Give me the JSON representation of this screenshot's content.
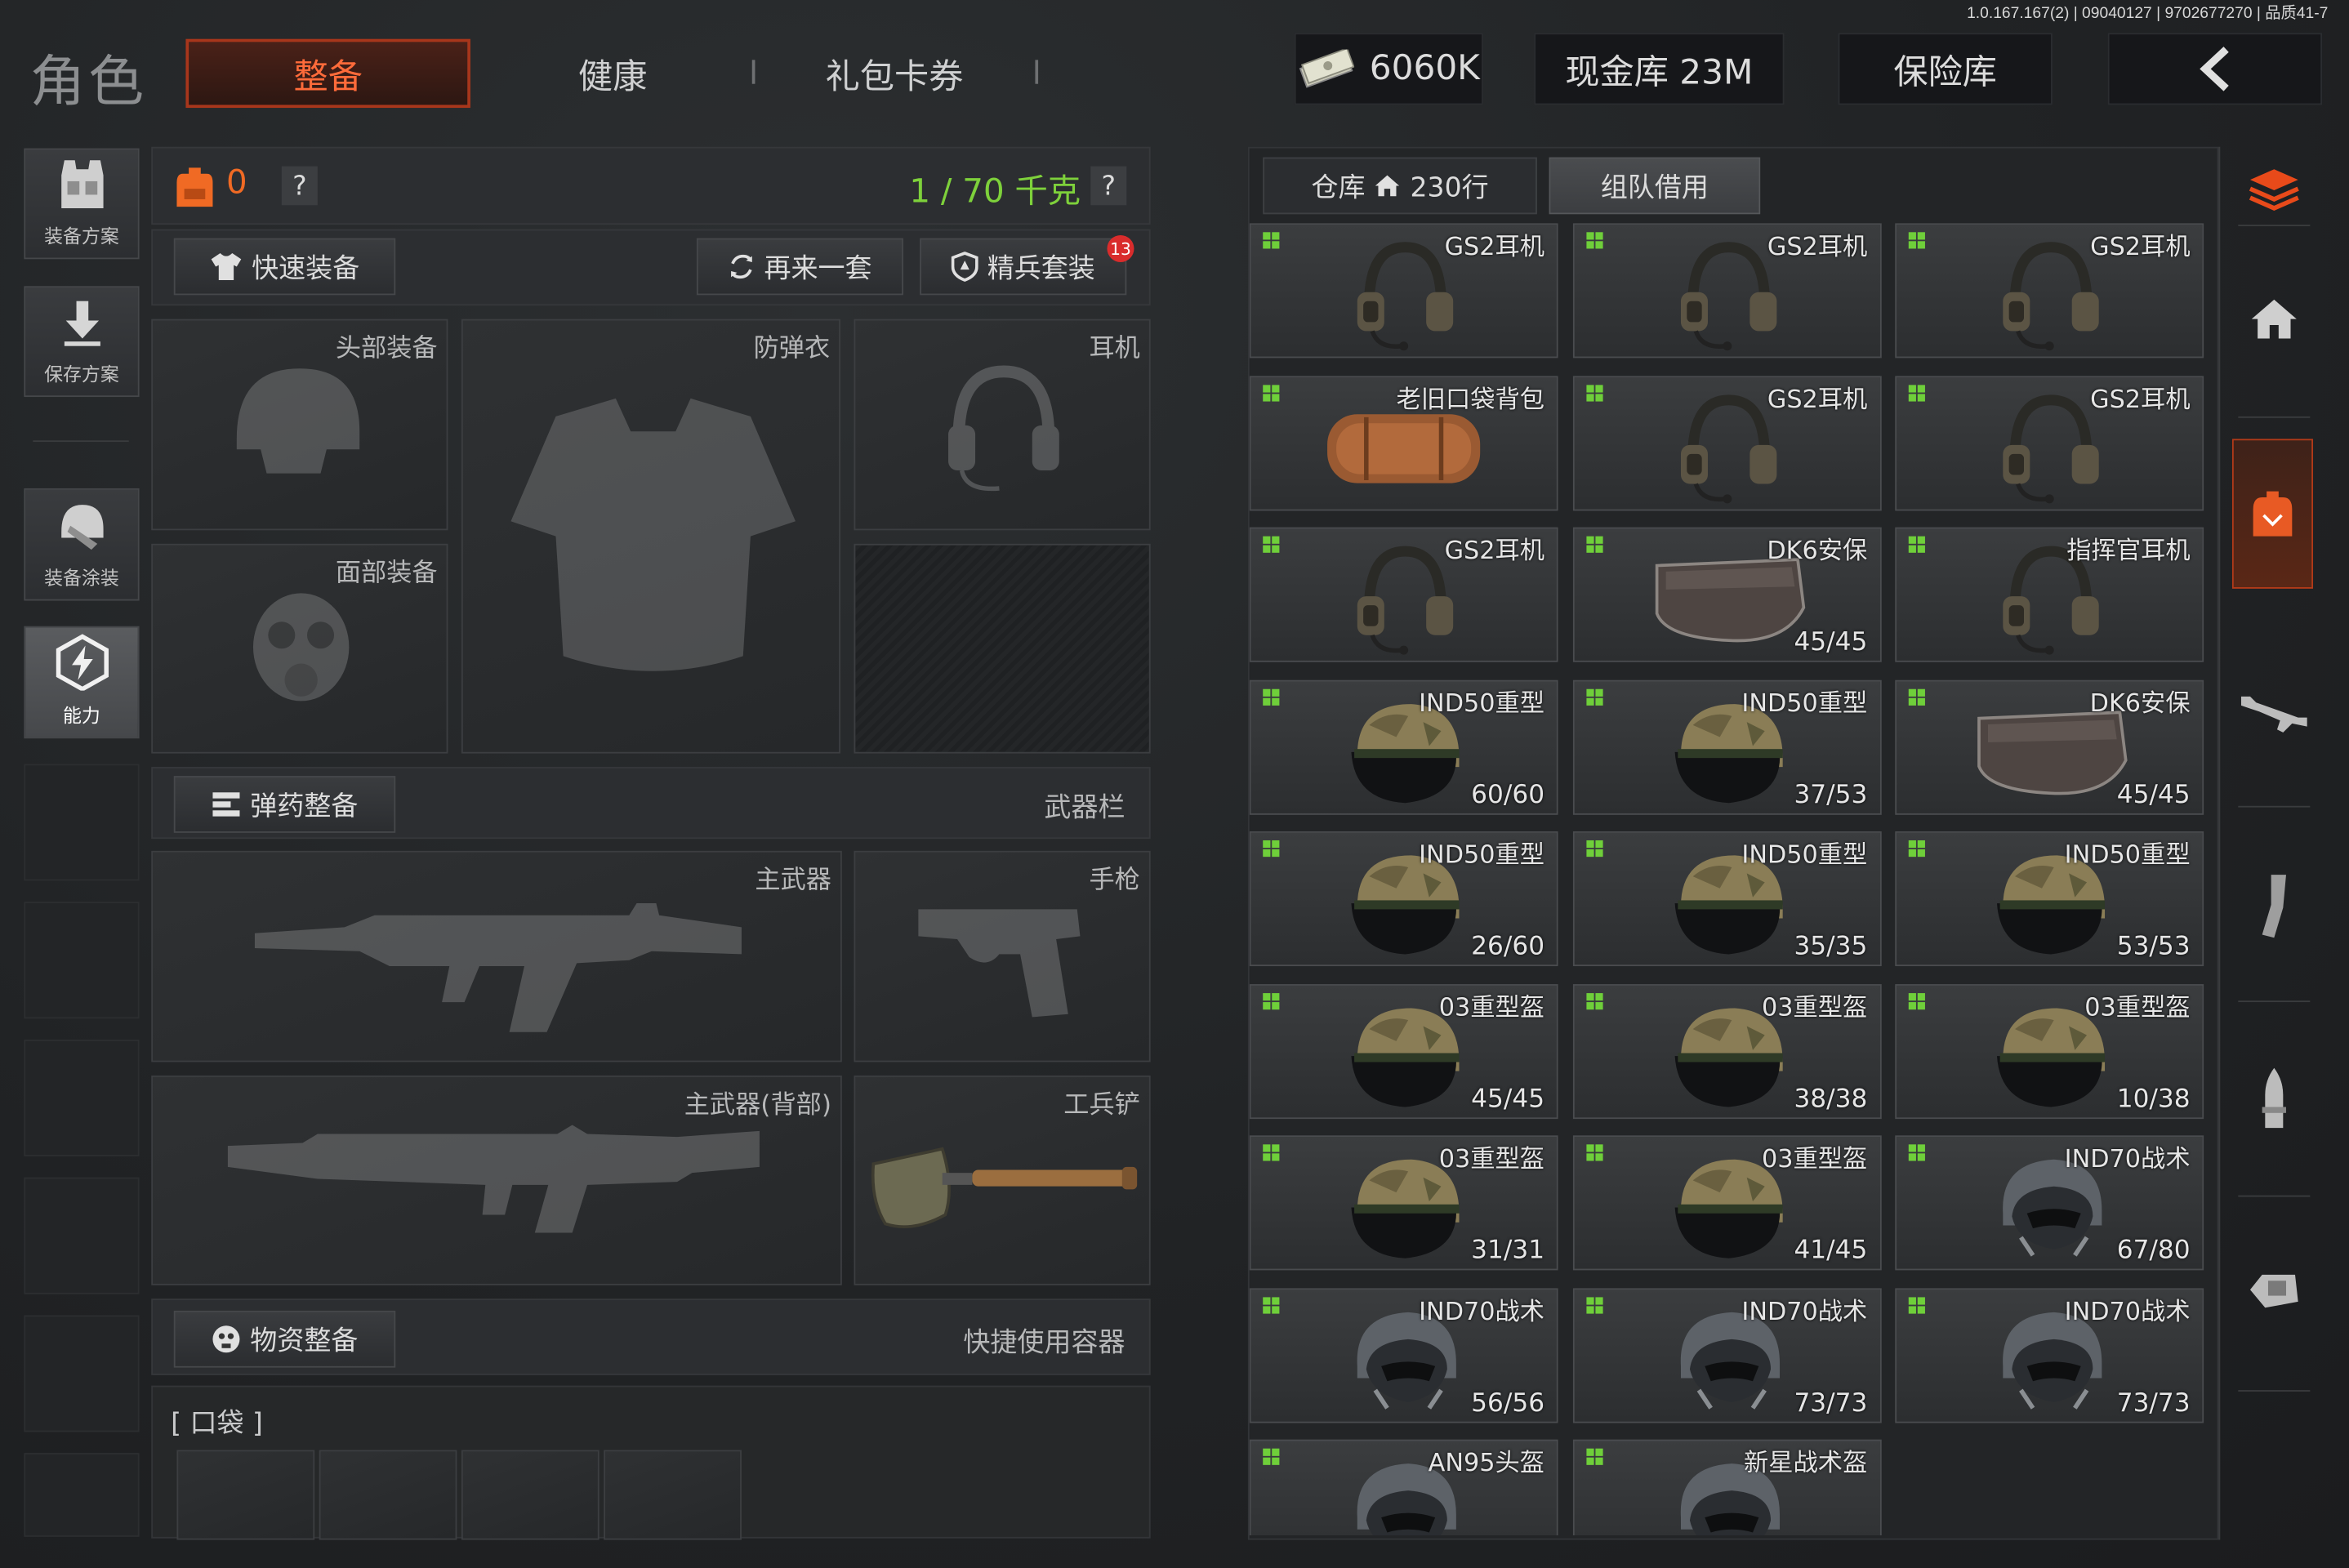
{
  "version": "1.0.167.167(2) | 09040127 | 9702677270 | 品质41-7",
  "header": {
    "title": "角色",
    "tabs": [
      "整备",
      "健康",
      "礼包卡券"
    ],
    "currency": "6060K",
    "cash_vault": "现金库 23M",
    "safe_box": "保险库"
  },
  "left_sidebar": [
    {
      "label": "装备方案",
      "icon": "vest-icon"
    },
    {
      "label": "保存方案",
      "icon": "download-icon"
    },
    {
      "label": "装备涂装",
      "icon": "helmet-paint-icon"
    },
    {
      "label": "能力",
      "icon": "ability-icon"
    }
  ],
  "loadout": {
    "backpack_count": "0",
    "weight": "1 / 70 千克",
    "help": "?",
    "quick_equip": "快速装备",
    "again": "再来一套",
    "elite_kit": "精兵套装",
    "elite_badge": "13",
    "slots": {
      "head": "头部装备",
      "armor": "防弹衣",
      "earphone": "耳机",
      "face": "面部装备",
      "primary": "主武器",
      "pistol": "手枪",
      "primary_back": "主武器(背部)",
      "shovel": "工兵铲"
    },
    "ammo_equip": "弹药整备",
    "weapon_bar": "武器栏",
    "supply_equip": "物资整备",
    "quick_container": "快捷使用容器",
    "pocket": "[ 口袋 ]"
  },
  "warehouse": {
    "tab_storage": "仓库",
    "rows": "230行",
    "tab_team": "组队借用",
    "items": [
      {
        "name": "GS2耳机",
        "dur": "",
        "type": "headset"
      },
      {
        "name": "GS2耳机",
        "dur": "",
        "type": "headset"
      },
      {
        "name": "GS2耳机",
        "dur": "",
        "type": "headset"
      },
      {
        "name": "老旧口袋背包",
        "dur": "",
        "type": "bag"
      },
      {
        "name": "GS2耳机",
        "dur": "",
        "type": "headset"
      },
      {
        "name": "GS2耳机",
        "dur": "",
        "type": "headset"
      },
      {
        "name": "GS2耳机",
        "dur": "",
        "type": "headset"
      },
      {
        "name": "DK6安保",
        "dur": "45/45",
        "type": "visor"
      },
      {
        "name": "指挥官耳机",
        "dur": "",
        "type": "headset"
      },
      {
        "name": "IND50重型",
        "dur": "60/60",
        "type": "helmet"
      },
      {
        "name": "IND50重型",
        "dur": "37/53",
        "type": "helmet"
      },
      {
        "name": "DK6安保",
        "dur": "45/45",
        "type": "visor"
      },
      {
        "name": "IND50重型",
        "dur": "26/60",
        "type": "helmet"
      },
      {
        "name": "IND50重型",
        "dur": "35/35",
        "type": "helmet"
      },
      {
        "name": "IND50重型",
        "dur": "53/53",
        "type": "helmet"
      },
      {
        "name": "03重型盔",
        "dur": "45/45",
        "type": "helmet"
      },
      {
        "name": "03重型盔",
        "dur": "38/38",
        "type": "helmet"
      },
      {
        "name": "03重型盔",
        "dur": "10/38",
        "type": "helmet"
      },
      {
        "name": "03重型盔",
        "dur": "31/31",
        "type": "helmet"
      },
      {
        "name": "03重型盔",
        "dur": "41/45",
        "type": "helmet"
      },
      {
        "name": "IND70战术",
        "dur": "67/80",
        "type": "tactical"
      },
      {
        "name": "IND70战术",
        "dur": "56/56",
        "type": "tactical"
      },
      {
        "name": "IND70战术",
        "dur": "73/73",
        "type": "tactical"
      },
      {
        "name": "IND70战术",
        "dur": "73/73",
        "type": "tactical"
      },
      {
        "name": "AN95头盔",
        "dur": "",
        "type": "tactical"
      },
      {
        "name": "新星战术盔",
        "dur": "",
        "type": "tactical"
      }
    ]
  },
  "right_sidebar": [
    "layers-icon",
    "home-icon",
    "backpack-icon",
    "rifle-icon",
    "magazine-icon",
    "bullet-icon",
    "sight-icon"
  ]
}
